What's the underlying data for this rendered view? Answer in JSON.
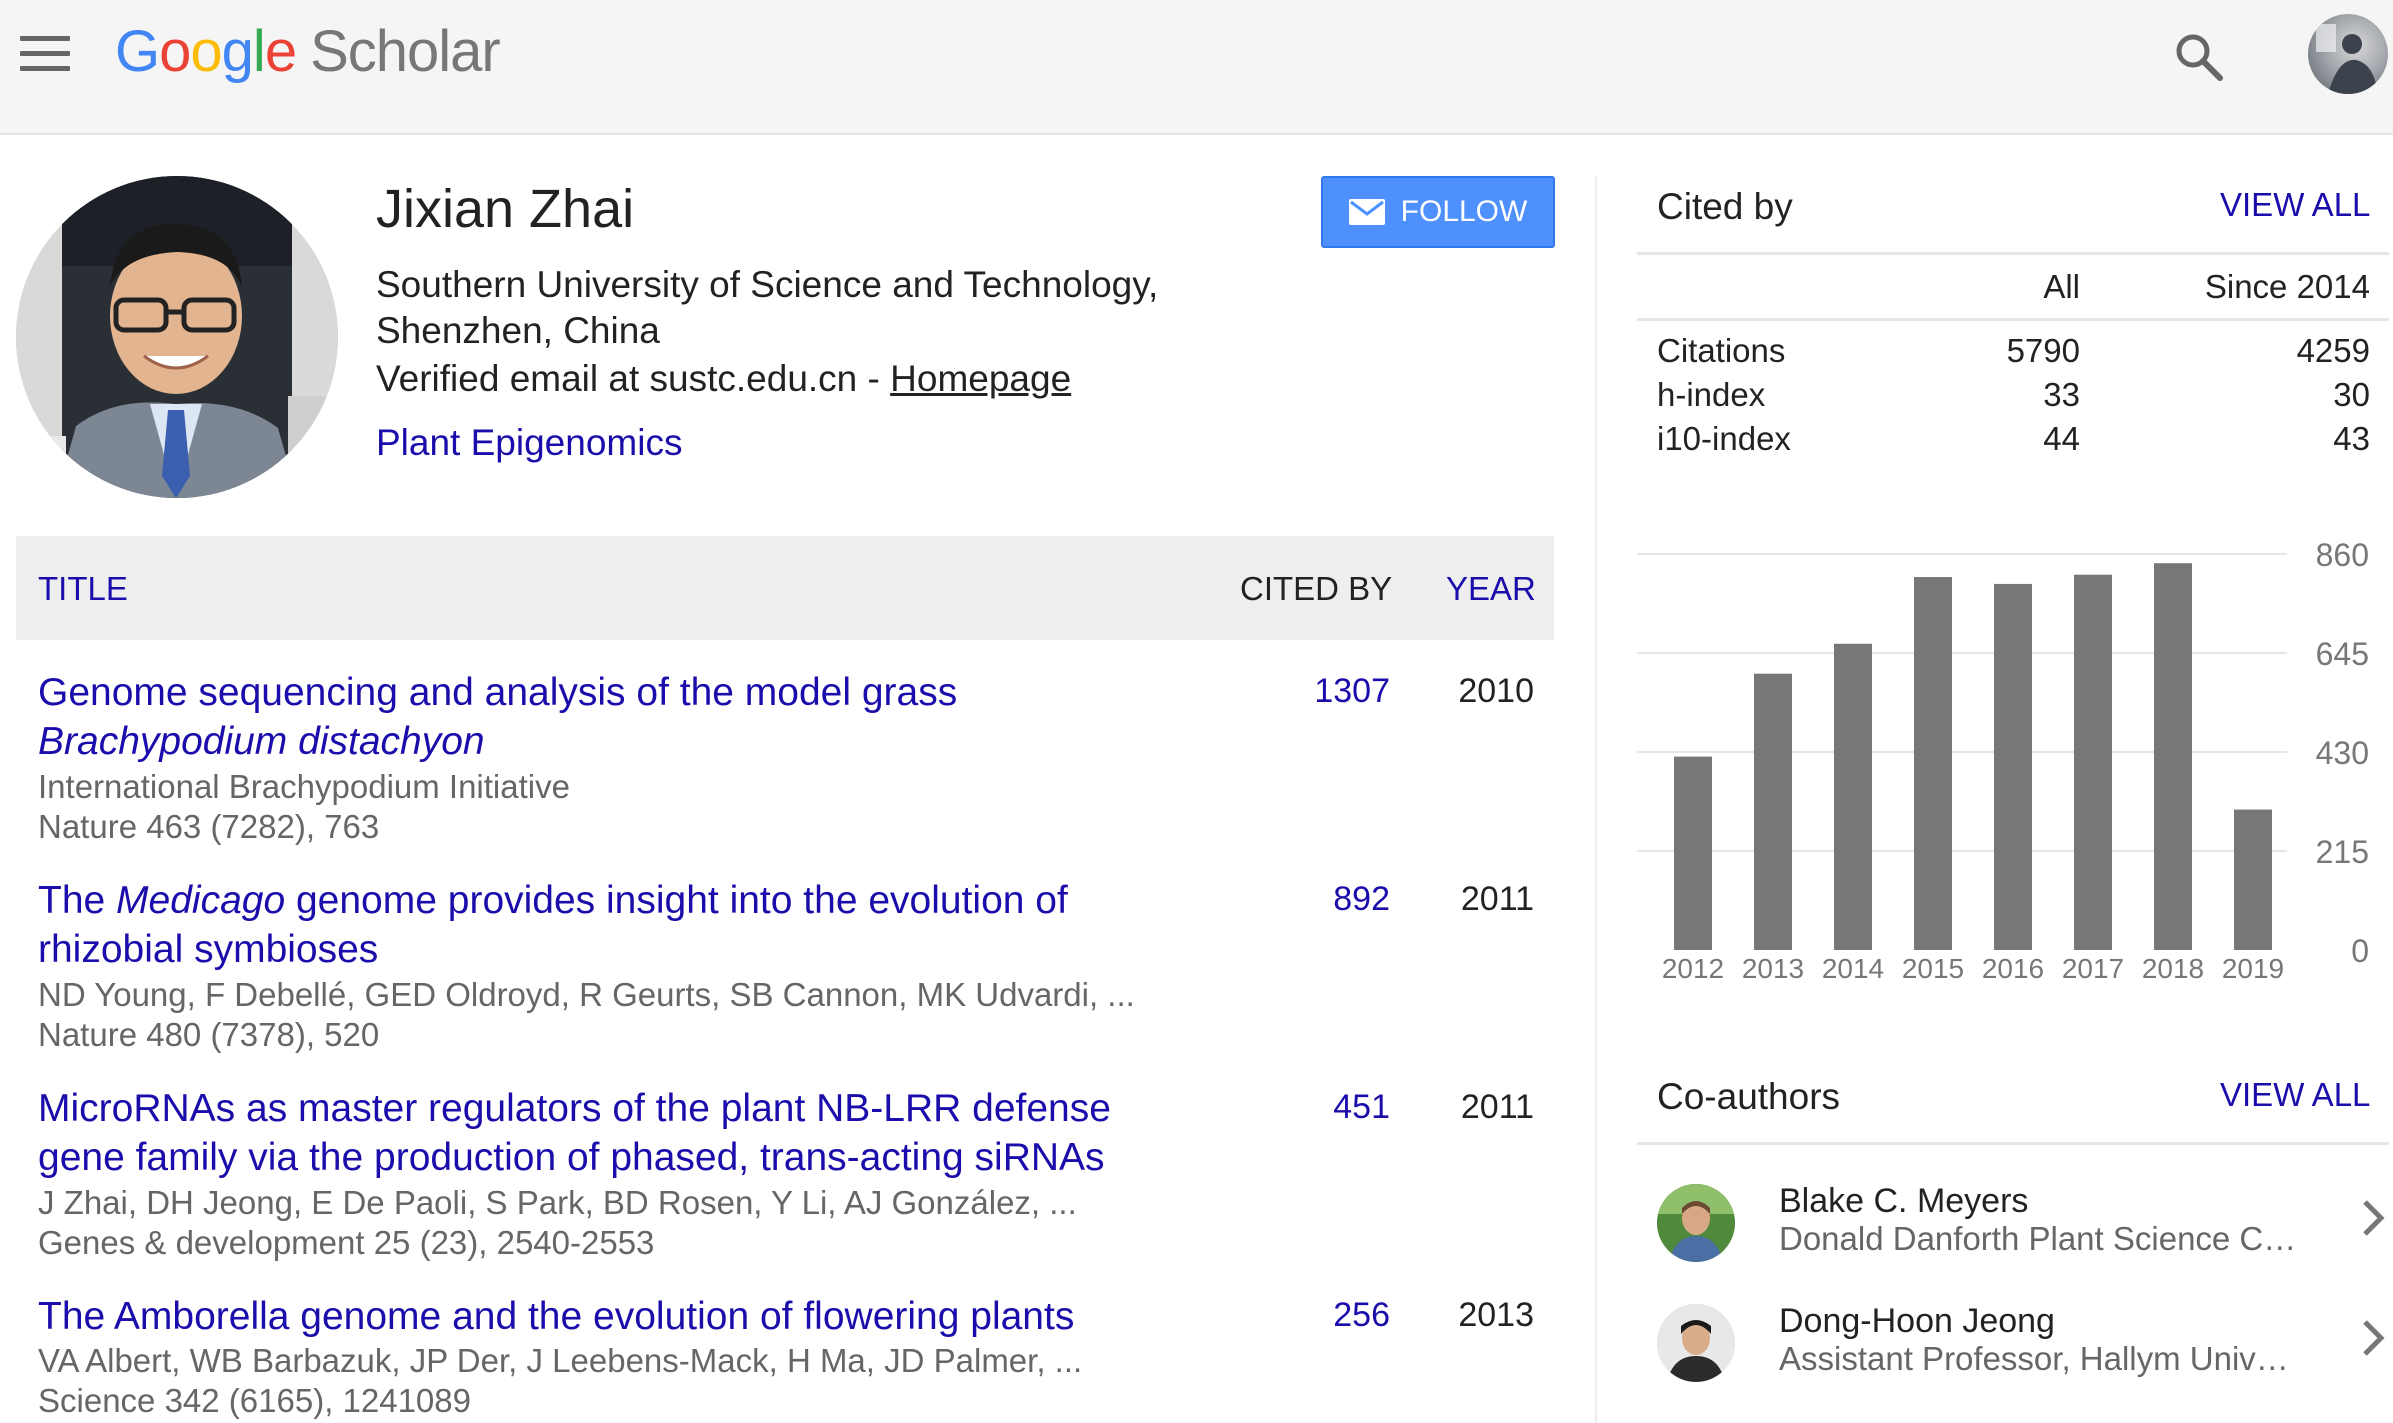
{
  "header": {
    "logo_google": [
      "G",
      "o",
      "o",
      "g",
      "l",
      "e"
    ],
    "logo_scholar": "Scholar",
    "icons": [
      "menu-icon",
      "search-icon",
      "account-avatar"
    ]
  },
  "profile": {
    "name": "Jixian Zhai",
    "affiliation": "Southern University of Science and Technology, Shenzhen, China",
    "email_text": "Verified email at sustc.edu.cn - ",
    "homepage_label": "Homepage",
    "interest": "Plant Epigenomics",
    "follow_label": "FOLLOW"
  },
  "table": {
    "col_title": "TITLE",
    "col_cited": "CITED BY",
    "col_year": "YEAR",
    "rows": [
      {
        "title_plain": "Genome sequencing and analysis of the model grass ",
        "title_italic": "Brachypodium distachyon",
        "title_rest": "",
        "authors": "International Brachypodium Initiative",
        "venue": "Nature 463 (7282), 763",
        "cited": "1307",
        "year": "2010"
      },
      {
        "title_plain": "The ",
        "title_italic": "Medicago",
        "title_rest": " genome provides insight into the evolution of rhizobial symbioses",
        "authors": "ND Young, F Debellé, GED Oldroyd, R Geurts, SB Cannon, MK Udvardi, ...",
        "venue": "Nature 480 (7378), 520",
        "cited": "892",
        "year": "2011"
      },
      {
        "title_plain": "MicroRNAs as master regulators of the plant NB-LRR defense gene family via the production of phased, trans-acting siRNAs",
        "title_italic": "",
        "title_rest": "",
        "authors": "J Zhai, DH Jeong, E De Paoli, S Park, BD Rosen, Y Li, AJ González, ...",
        "venue": "Genes & development 25 (23), 2540-2553",
        "cited": "451",
        "year": "2011"
      },
      {
        "title_plain": "The Amborella genome and the evolution of flowering plants",
        "title_italic": "",
        "title_rest": "",
        "authors": "VA Albert, WB Barbazuk, JP Der, J Leebens-Mack, H Ma, JD Palmer, ...",
        "venue": "Science 342 (6165), 1241089",
        "cited": "256",
        "year": "2013"
      }
    ]
  },
  "cited_by": {
    "title": "Cited by",
    "view_all": "VIEW ALL",
    "col_all": "All",
    "col_since": "Since 2014",
    "rows": [
      {
        "label": "Citations",
        "all": "5790",
        "since": "4259"
      },
      {
        "label": "h-index",
        "all": "33",
        "since": "30"
      },
      {
        "label": "i10-index",
        "all": "44",
        "since": "43"
      }
    ]
  },
  "chart_data": {
    "type": "bar",
    "categories": [
      "2012",
      "2013",
      "2014",
      "2015",
      "2016",
      "2017",
      "2018",
      "2019"
    ],
    "values": [
      420,
      600,
      665,
      810,
      795,
      815,
      840,
      305
    ],
    "ylim": [
      0,
      860
    ],
    "yticks": [
      "0",
      "215",
      "430",
      "645",
      "860"
    ],
    "title": "",
    "xlabel": "",
    "ylabel": "",
    "bar_color": "#777777",
    "grid": true
  },
  "coauthors": {
    "title": "Co-authors",
    "view_all": "VIEW ALL",
    "items": [
      {
        "name": "Blake C. Meyers",
        "affiliation": "Donald Danforth Plant Science C…"
      },
      {
        "name": "Dong-Hoon Jeong",
        "affiliation": "Assistant Professor, Hallym Univ…"
      }
    ]
  }
}
